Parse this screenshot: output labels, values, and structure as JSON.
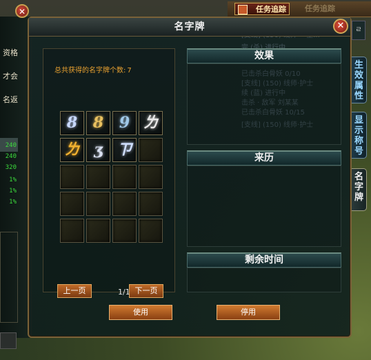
{
  "top_bar": {
    "task_tracking_label": "任务追踪",
    "task_tracking_label_2": "任务追踪"
  },
  "background_panel": {
    "labels": [
      "资格",
      "才会",
      "名返"
    ],
    "values": [
      "240",
      "240",
      "320",
      "1%",
      "1%",
      "1%"
    ]
  },
  "background_quest_text": [
    "[支线] (150) 线师·一星...",
    "完 (杀) 进行中",
    "已击杀白骨妖   0/10",
    "[支线] (150) 线师·护士",
    "续 (蓝) 进行中",
    "击杀 · 敌军  刘某某",
    "已击杀白骨妖  10/15",
    "[支线] (150) 线师·护士"
  ],
  "dialog": {
    "title": "名字牌",
    "close_glyph": "✕",
    "count_label": "总共获得的名字牌个数:",
    "count_value": "7",
    "plates": [
      {
        "glyph": "8",
        "color": "#c8d8ff"
      },
      {
        "glyph": "8",
        "color": "#e8c060"
      },
      {
        "glyph": "9",
        "color": "#a0c8e8"
      },
      {
        "glyph": "ㄌ",
        "color": "#e8e8e8"
      },
      {
        "glyph": "ㄌ",
        "color": "#f0b030"
      },
      {
        "glyph": "ʒ",
        "color": "#d8e0f0"
      },
      {
        "glyph": "ㄗ",
        "color": "#d0e0ff"
      }
    ],
    "slot_count": 20,
    "prev_page": "上一页",
    "page_indicator": "1/1",
    "next_page": "下一页",
    "section_effect": "效果",
    "section_origin": "来历",
    "section_remaining": "剩余时间",
    "use_button": "使用",
    "disable_button": "停用"
  },
  "side_tabs": [
    {
      "label": "生效属性"
    },
    {
      "label": "显示称号"
    },
    {
      "label": "名字牌"
    }
  ]
}
